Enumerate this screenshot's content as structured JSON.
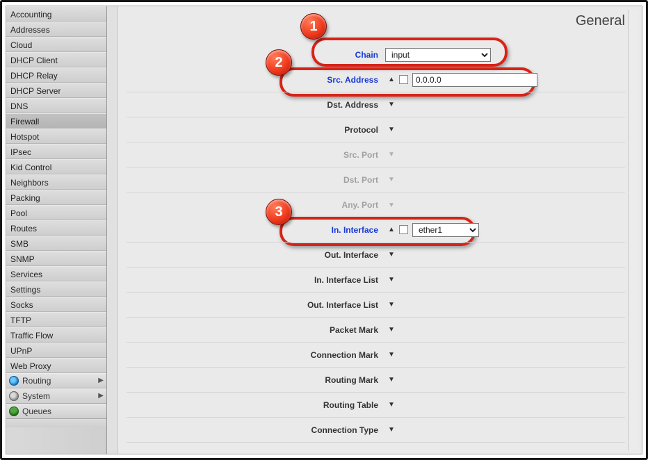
{
  "sidebar": {
    "items": [
      "Accounting",
      "Addresses",
      "Cloud",
      "DHCP Client",
      "DHCP Relay",
      "DHCP Server",
      "DNS",
      "Firewall",
      "Hotspot",
      "IPsec",
      "Kid Control",
      "Neighbors",
      "Packing",
      "Pool",
      "Routes",
      "SMB",
      "SNMP",
      "Services",
      "Settings",
      "Socks",
      "TFTP",
      "Traffic Flow",
      "UPnP",
      "Web Proxy"
    ],
    "active_index": 7,
    "groups": [
      "Routing",
      "System",
      "Queues"
    ]
  },
  "header": {
    "title": "General"
  },
  "badges": [
    "1",
    "2",
    "3"
  ],
  "form": {
    "chain": {
      "label": "Chain",
      "value": "input",
      "collapsed": false
    },
    "src_address": {
      "label": "Src. Address",
      "value": "0.0.0.0",
      "collapsed": false
    },
    "dst_address": {
      "label": "Dst. Address",
      "collapsed": true
    },
    "protocol": {
      "label": "Protocol",
      "collapsed": true
    },
    "src_port": {
      "label": "Src. Port",
      "collapsed": true,
      "disabled": true
    },
    "dst_port": {
      "label": "Dst. Port",
      "collapsed": true,
      "disabled": true
    },
    "any_port": {
      "label": "Any. Port",
      "collapsed": true,
      "disabled": true
    },
    "in_interface": {
      "label": "In. Interface",
      "value": "ether1",
      "collapsed": false
    },
    "out_interface": {
      "label": "Out. Interface",
      "collapsed": true
    },
    "in_iflist": {
      "label": "In. Interface List",
      "collapsed": true
    },
    "out_iflist": {
      "label": "Out. Interface List",
      "collapsed": true
    },
    "packet_mark": {
      "label": "Packet Mark",
      "collapsed": true
    },
    "conn_mark": {
      "label": "Connection Mark",
      "collapsed": true
    },
    "routing_mark": {
      "label": "Routing Mark",
      "collapsed": true
    },
    "routing_table": {
      "label": "Routing Table",
      "collapsed": true
    },
    "conn_type": {
      "label": "Connection Type",
      "collapsed": true
    }
  }
}
